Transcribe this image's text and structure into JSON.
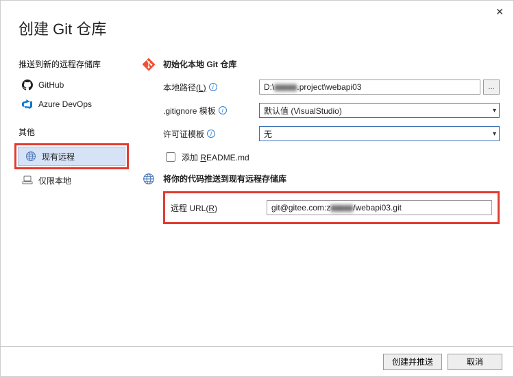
{
  "dialog": {
    "title": "创建 Git 仓库"
  },
  "sidebar": {
    "remote_header": "推送到新的远程存储库",
    "items": [
      {
        "label": "GitHub"
      },
      {
        "label": "Azure DevOps"
      }
    ],
    "other_header": "其他",
    "other_items": [
      {
        "label": "现有远程"
      },
      {
        "label": "仅限本地"
      }
    ]
  },
  "init": {
    "title": "初始化本地 Git 仓库",
    "local_path_label": "本地路径",
    "local_path_hotkey": "(L)",
    "local_path_prefix": "D:\\",
    "local_path_blur": "▮▮▮▮▮",
    "local_path_suffix": ".project\\webapi03",
    "browse_label": "...",
    "gitignore_label": ".gitignore 模板",
    "gitignore_value": "默认值 (VisualStudio)",
    "license_label": "许可证模板",
    "license_value": "无",
    "readme_label": "添加 README.md",
    "readme_hotkey": "R"
  },
  "push": {
    "title": "将你的代码推送到现有远程存储库",
    "remote_label": "远程 URL",
    "remote_hotkey": "(R)",
    "remote_prefix": "git@gitee.com:z",
    "remote_blur": "▮▮▮▮▮",
    "remote_suffix": "/webapi03.git"
  },
  "buttons": {
    "create": "创建并推送",
    "cancel": "取消"
  }
}
